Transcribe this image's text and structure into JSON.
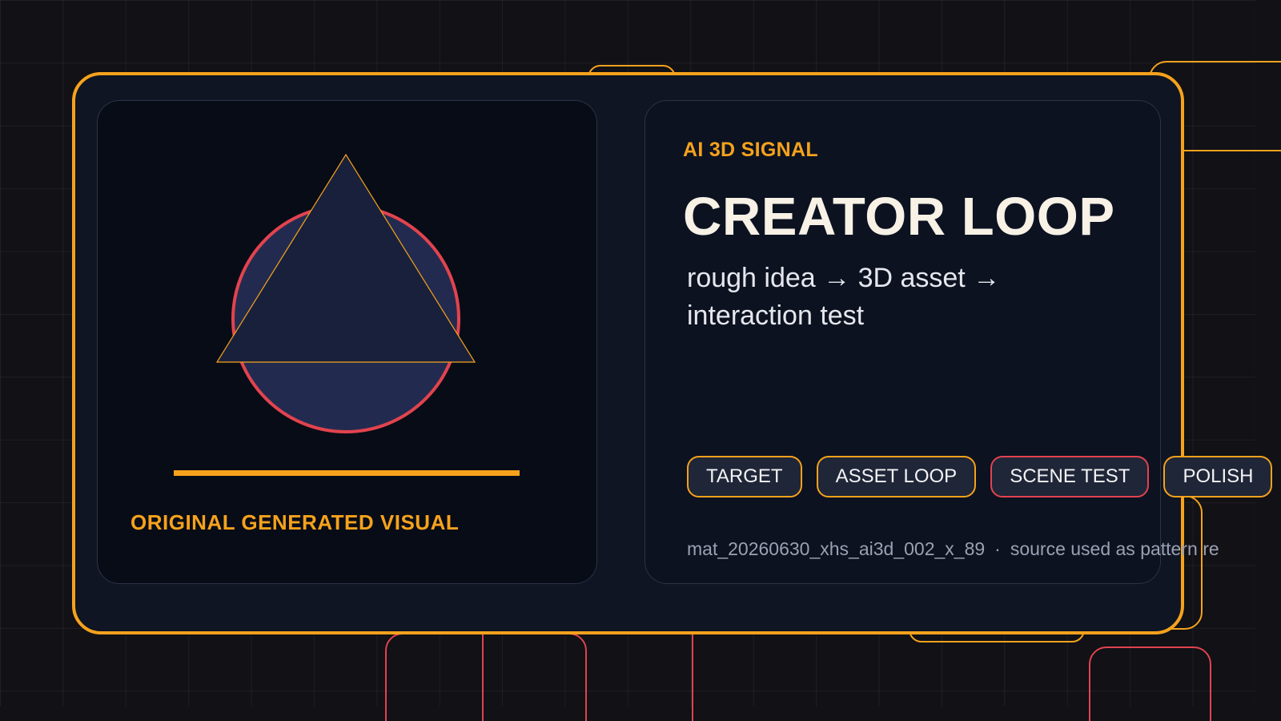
{
  "colors": {
    "accent": "#f6a21c",
    "alert": "#e2434f",
    "background": "#111116",
    "card": "#0f1522",
    "headline": "#f7f1e6"
  },
  "visual_panel": {
    "art_icon": "triangle-over-circle",
    "caption": "ORIGINAL GENERATED VISUAL"
  },
  "text_panel": {
    "eyebrow": "AI 3D SIGNAL",
    "headline": "CREATOR LOOP",
    "subline": "rough idea → 3D asset → interaction test",
    "chips": [
      {
        "label": "TARGET",
        "color": "#f6a21c"
      },
      {
        "label": "ASSET LOOP",
        "color": "#f6a21c"
      },
      {
        "label": "SCENE TEST",
        "color": "#e2434f"
      },
      {
        "label": "POLISH",
        "color": "#f6a21c"
      }
    ],
    "source_id": "mat_20260630_xhs_ai3d_002_x_89",
    "separator": "·",
    "source_note": "source used as pattern re"
  }
}
